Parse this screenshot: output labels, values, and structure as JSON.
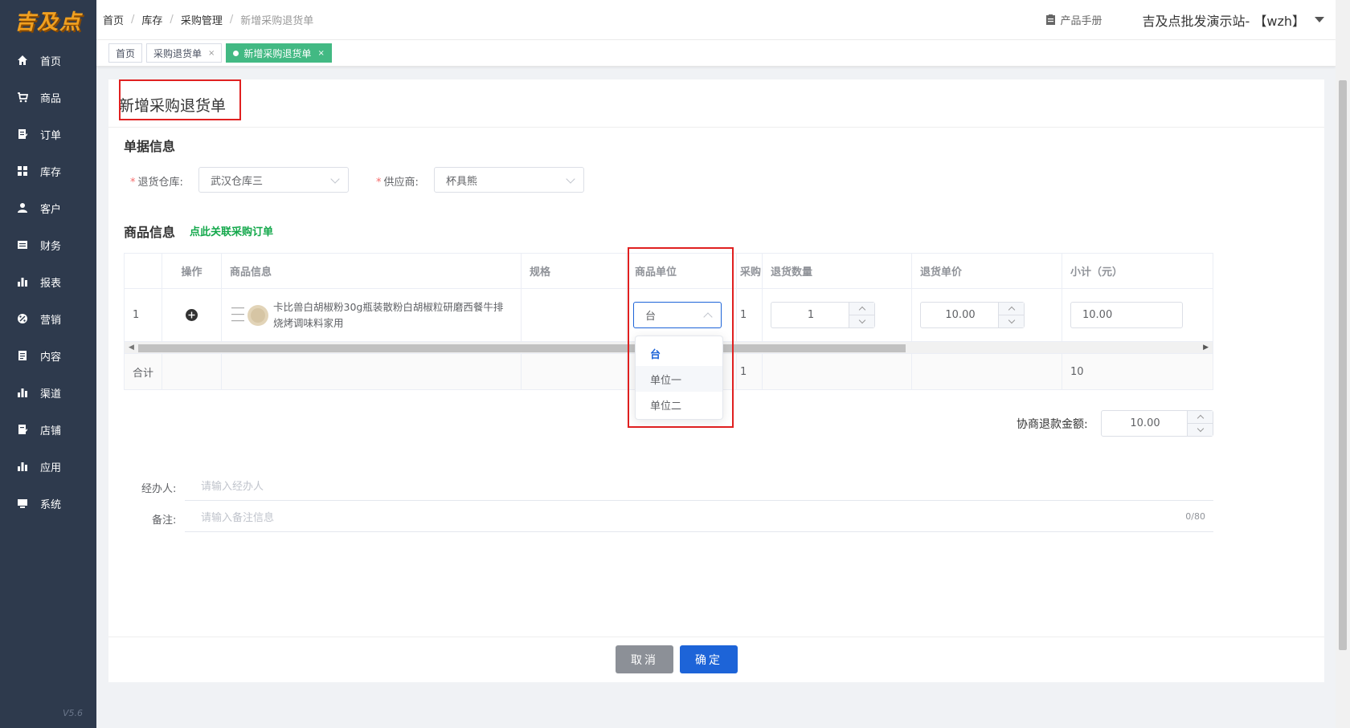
{
  "app": {
    "logo_text": "吉及点",
    "version": "V5.6"
  },
  "sidebar": {
    "items": [
      {
        "label": "首页",
        "icon": "home-icon"
      },
      {
        "label": "商品",
        "icon": "cart-icon"
      },
      {
        "label": "订单",
        "icon": "order-icon"
      },
      {
        "label": "库存",
        "icon": "grid-icon"
      },
      {
        "label": "客户",
        "icon": "user-icon"
      },
      {
        "label": "财务",
        "icon": "finance-icon"
      },
      {
        "label": "报表",
        "icon": "bar-chart-icon"
      },
      {
        "label": "营销",
        "icon": "marketing-icon"
      },
      {
        "label": "内容",
        "icon": "content-icon"
      },
      {
        "label": "渠道",
        "icon": "bar-chart-icon"
      },
      {
        "label": "店铺",
        "icon": "store-icon"
      },
      {
        "label": "应用",
        "icon": "bar-chart-icon"
      },
      {
        "label": "系统",
        "icon": "monitor-icon"
      }
    ]
  },
  "header": {
    "breadcrumb": [
      "首页",
      "库存",
      "采购管理",
      "新增采购退货单"
    ],
    "manual_label": "产品手册",
    "site_user": "吉及点批发演示站- 【wzh】"
  },
  "tabs": [
    {
      "label": "首页",
      "closable": false,
      "active": false
    },
    {
      "label": "采购退货单",
      "closable": true,
      "active": false
    },
    {
      "label": "新增采购退货单",
      "closable": true,
      "active": true
    }
  ],
  "page": {
    "title": "新增采购退货单",
    "doc_section": "单据信息",
    "warehouse_label": "退货仓库:",
    "warehouse_value": "武汉仓库三",
    "supplier_label": "供应商:",
    "supplier_value": "杯具熊",
    "goods_section": "商品信息",
    "link_order": "点此关联采购订单"
  },
  "table": {
    "headers": [
      "",
      "操作",
      "商品信息",
      "规格",
      "商品单位",
      "采购",
      "退货数量",
      "退货单价",
      "小计（元）"
    ],
    "row": {
      "index": "1",
      "product_name": "卡比兽白胡椒粉30g瓶装散粉白胡椒粒研磨西餐牛排烧烤调味料家用",
      "spec": "",
      "unit": "台",
      "purchase_qty": "1",
      "return_qty": "1",
      "return_price": "10.00",
      "subtotal": "10.00"
    },
    "footer": {
      "label": "合计",
      "purchase_total": "1",
      "subtotal_total": "10"
    }
  },
  "unit_dropdown": {
    "options": [
      "台",
      "单位一",
      "单位二"
    ],
    "selected": "台",
    "hovered": "单位一"
  },
  "refund": {
    "label": "协商退款金额:",
    "value": "10.00"
  },
  "form": {
    "handler_label": "经办人:",
    "handler_placeholder": "请输入经办人",
    "remark_label": "备注:",
    "remark_placeholder": "请输入备注信息",
    "remark_count": "0/80"
  },
  "actions": {
    "cancel": "取消",
    "ok": "确定"
  },
  "colors": {
    "sidebar": "#2e3a4d",
    "accent_green": "#42b983",
    "primary": "#1d64d8",
    "highlight": "#e02020"
  }
}
